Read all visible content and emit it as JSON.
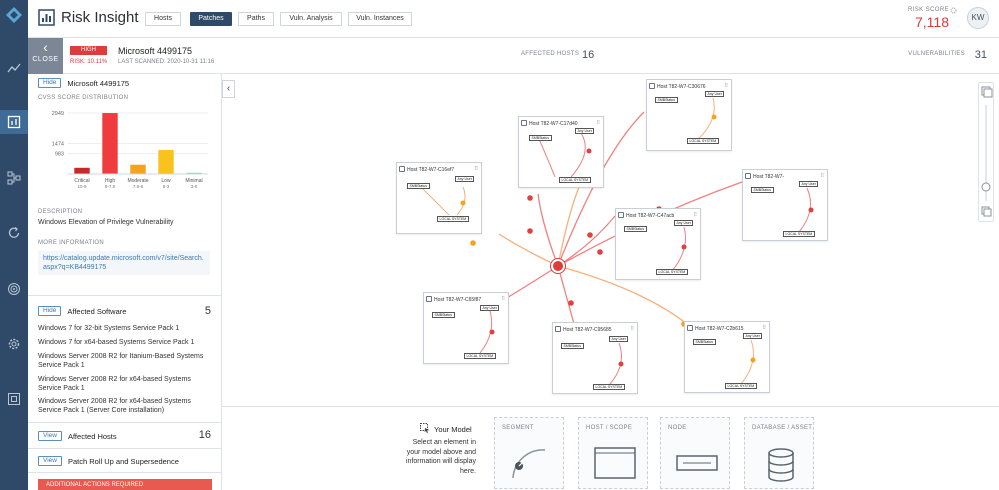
{
  "header": {
    "app_title": "Risk Insight",
    "tabs": [
      "Hosts",
      "Patches",
      "Paths",
      "Vuln. Analysis",
      "Vuln. Instances"
    ],
    "active_tab": "Patches",
    "risk_score_label": "RISK SCORE",
    "risk_score_value": "7,118",
    "user_initials": "KW"
  },
  "subheader": {
    "close_label": "CLOSE",
    "severity": "HIGH",
    "risk_pct": "RISK: 10.11%",
    "patch_name": "Microsoft 4499175",
    "last_scanned": "LAST SCANNED: 2020-10-31 11:16",
    "affected_hosts_label": "AFFECTED HOSTS",
    "affected_hosts_value": "16",
    "vulnerabilities_label": "VULNERABILITIES",
    "vulnerabilities_value": "31"
  },
  "panel": {
    "hide_label": "Hide",
    "patch_title": "Microsoft 4499175",
    "cvss_label": "CVSS SCORE DISTRIBUTION",
    "description_label": "DESCRIPTION",
    "description_value": "Windows Elevation of Privilege Vulnerability",
    "more_info_label": "MORE INFORMATION",
    "more_info_link": "https://catalog.update.microsoft.com/v7/site/Search.aspx?q=KB4499175",
    "software_hide": "Hide",
    "software_title": "Affected Software",
    "software_count": "5",
    "software": [
      "Windows 7 for 32-bit Systems Service Pack 1",
      "Windows 7 for x64-based Systems Service Pack 1",
      "Windows Server 2008 R2 for Itanium-Based Systems Service Pack 1",
      "Windows Server 2008 R2 for x64-based Systems Service Pack 1",
      "Windows Server 2008 R2 for x64-based Systems Service Pack 1 (Server Core installation)"
    ],
    "hosts_view": "View",
    "hosts_title": "Affected Hosts",
    "hosts_count": "16",
    "rollup_view": "View",
    "rollup_title": "Patch Roll Up and Supersedence",
    "warning": "ADDITIONAL ACTIONS REQUIRED"
  },
  "chart_data": {
    "type": "bar",
    "categories": [
      "Critical",
      "High",
      "Moderate",
      "Low",
      "Minimal"
    ],
    "ranges": [
      "10-9",
      "9-7.5",
      "7.5-6",
      "6-3",
      "3-0"
    ],
    "values": [
      300,
      2949,
      450,
      1160,
      60
    ],
    "colors": [
      "#c62828",
      "#f03c3c",
      "#f6a21a",
      "#f9c21c",
      "#8fd3c0"
    ],
    "yticks": [
      "2949",
      "1474",
      "983"
    ],
    "ylim": [
      0,
      3000
    ]
  },
  "hosts": [
    {
      "name": "Host T82-W7-C16ef7"
    },
    {
      "name": "Host T82-W7-C17d40"
    },
    {
      "name": "Host T82-W7-C30676"
    },
    {
      "name": "Host T82-W7-"
    },
    {
      "name": "Host T82-W7-C47acb"
    },
    {
      "name": "Host T82-W7-C65f87"
    },
    {
      "name": "Host T82-W7-C95685"
    },
    {
      "name": "Host T82-W7-C2b615"
    }
  ],
  "node_labels": {
    "software": "SMBStatus",
    "user": "Any User",
    "system": "LOCAL SYSTEM"
  },
  "model": {
    "title": "Your Model",
    "text": "Select an element in your model above and information will display here.",
    "cards": [
      "SEGMENT",
      "HOST / SCOPE",
      "NODE",
      "DATABASE / ASSET"
    ]
  }
}
